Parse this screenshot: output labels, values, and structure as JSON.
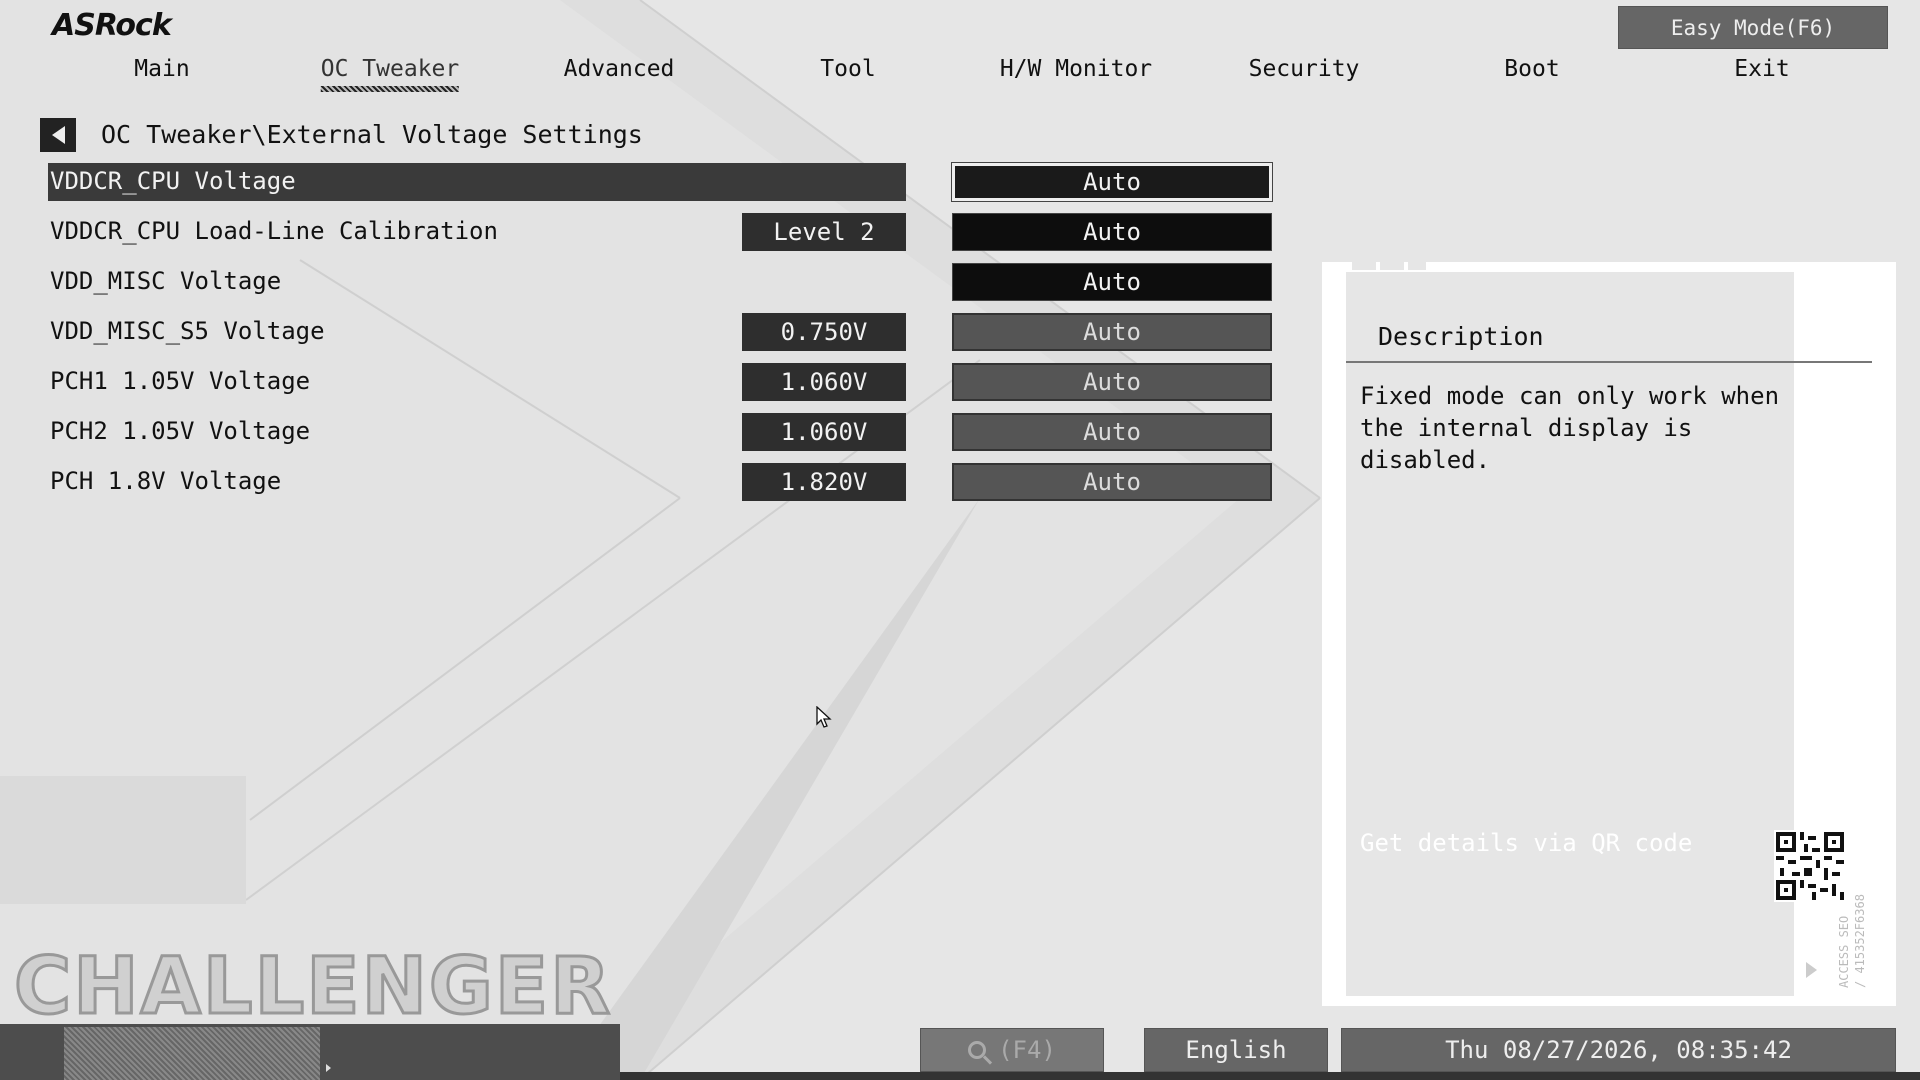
{
  "brand": "ASRock",
  "header": {
    "easy_mode_label": "Easy Mode(F6)"
  },
  "nav": {
    "tabs": [
      {
        "label": "Main",
        "active": false
      },
      {
        "label": "OC Tweaker",
        "active": true
      },
      {
        "label": "Advanced",
        "active": false
      },
      {
        "label": "Tool",
        "active": false
      },
      {
        "label": "H/W Monitor",
        "active": false
      },
      {
        "label": "Security",
        "active": false
      },
      {
        "label": "Boot",
        "active": false
      },
      {
        "label": "Exit",
        "active": false
      }
    ]
  },
  "breadcrumb": "OC Tweaker\\External Voltage Settings",
  "settings": [
    {
      "label": "VDDCR_CPU Voltage",
      "current": "",
      "option": "Auto",
      "selected": true
    },
    {
      "label": "VDDCR_CPU Load-Line Calibration",
      "current": "Level 2",
      "option": "Auto"
    },
    {
      "label": "VDD_MISC Voltage",
      "current": "",
      "option": "Auto"
    },
    {
      "label": "VDD_MISC_S5 Voltage",
      "current": "0.750V",
      "option": "Auto"
    },
    {
      "label": "PCH1 1.05V Voltage",
      "current": "1.060V",
      "option": "Auto"
    },
    {
      "label": "PCH2 1.05V Voltage",
      "current": "1.060V",
      "option": "Auto"
    },
    {
      "label": "PCH 1.8V Voltage",
      "current": "1.820V",
      "option": "Auto"
    }
  ],
  "description": {
    "title": "Description",
    "text": "Fixed mode can only work when the internal display is disabled.",
    "qr_text": "Get details via QR code",
    "access_text": "ACCESS SEO\n/ 415352F6368"
  },
  "footer": {
    "watermark": "CHALLENGER",
    "search_label": "(F4)",
    "language": "English",
    "datetime": "Thu 08/27/2026, 08:35:42"
  },
  "colors": {
    "background": "#e6e6e6",
    "dark_button": "#0d0d0d",
    "gray_button": "#555555",
    "panel": "#ffffff"
  }
}
